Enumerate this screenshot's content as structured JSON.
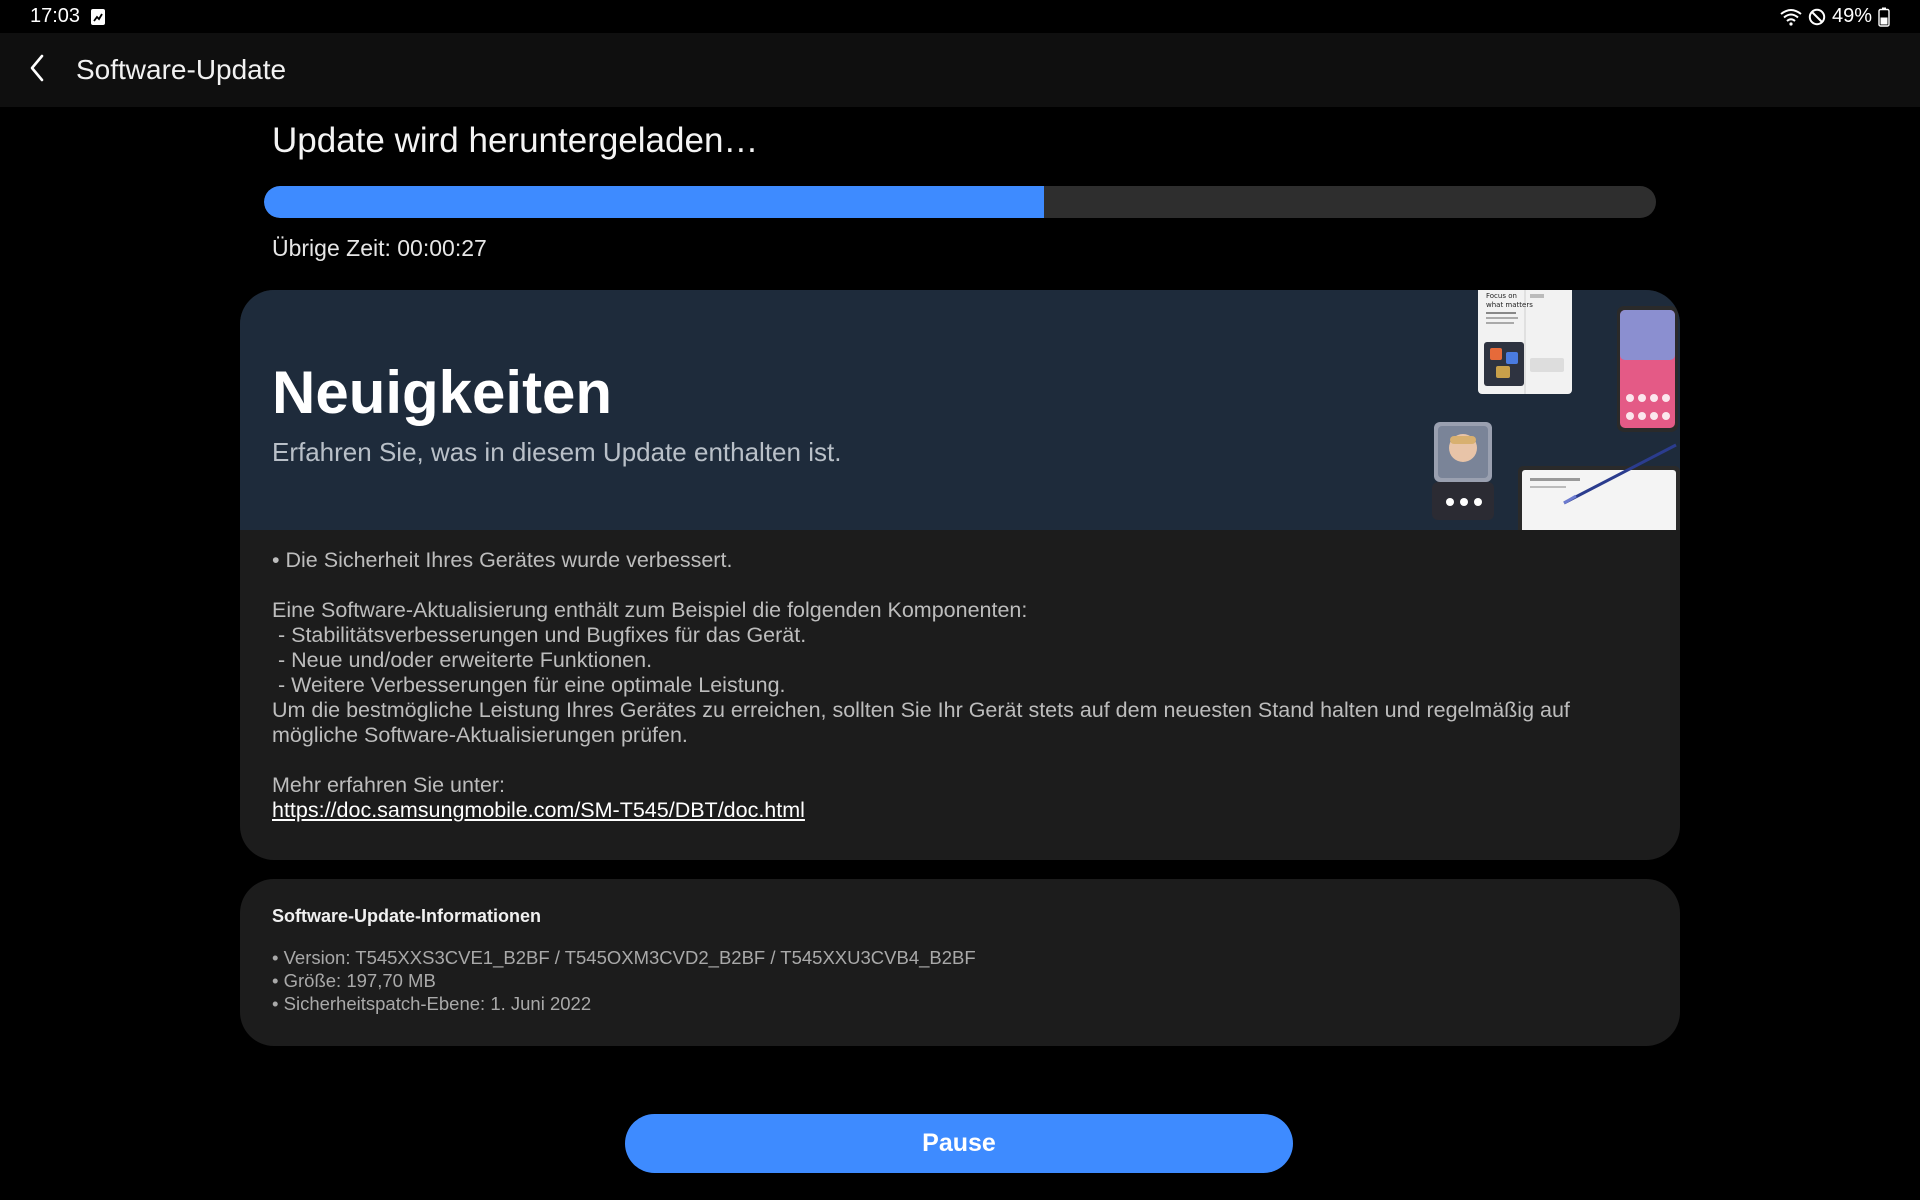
{
  "status_bar": {
    "time": "17:03",
    "battery": "49%",
    "icons": [
      "notification-image-icon",
      "wifi-icon",
      "do-not-disturb-icon",
      "battery-icon"
    ]
  },
  "app_bar": {
    "back_icon": "chevron-left-icon",
    "title": "Software-Update"
  },
  "download": {
    "title": "Update wird heruntergeladen…",
    "progress": 0.56,
    "remaining": "Übrige Zeit: 00:00:27"
  },
  "news": {
    "title": "Neuigkeiten",
    "subtitle": "Erfahren Sie, was in diesem Update enthalten ist.",
    "security_line": "• Die Sicherheit Ihres Gerätes wurde verbessert.",
    "intro": "Eine Software-Aktualisierung enthält zum Beispiel die folgenden Komponenten:",
    "items": [
      " - Stabilitätsverbesserungen und Bugfixes für das Gerät.",
      " - Neue und/oder erweiterte Funktionen.",
      " - Weitere Verbesserungen für eine optimale Leistung."
    ],
    "advice_line1": "Um die bestmögliche Leistung Ihres Gerätes zu erreichen, sollten Sie Ihr Gerät stets auf dem neuesten Stand halten und regelmäßig auf",
    "advice_line2": "mögliche Software-Aktualisierungen prüfen.",
    "more_label": "Mehr erfahren Sie unter:",
    "link": "https://doc.samsungmobile.com/SM-T545/DBT/doc.html",
    "art_text": "Focus on what matters",
    "art_text_line1": "Focus on",
    "art_text_line2": "what matters"
  },
  "info": {
    "title": "Software-Update-Informationen",
    "version": "• Version: T545XXS3CVE1_B2BF / T545OXM3CVD2_B2BF / T545XXU3CVB4_B2BF",
    "size": "• Größe: 197,70 MB",
    "patch": "• Sicherheitspatch-Ebene: 1. Juni 2022"
  },
  "actions": {
    "pause_label": "Pause"
  },
  "colors": {
    "accent": "#3e8bff",
    "banner": "#1e2b3b",
    "card": "#1c1c1c"
  }
}
